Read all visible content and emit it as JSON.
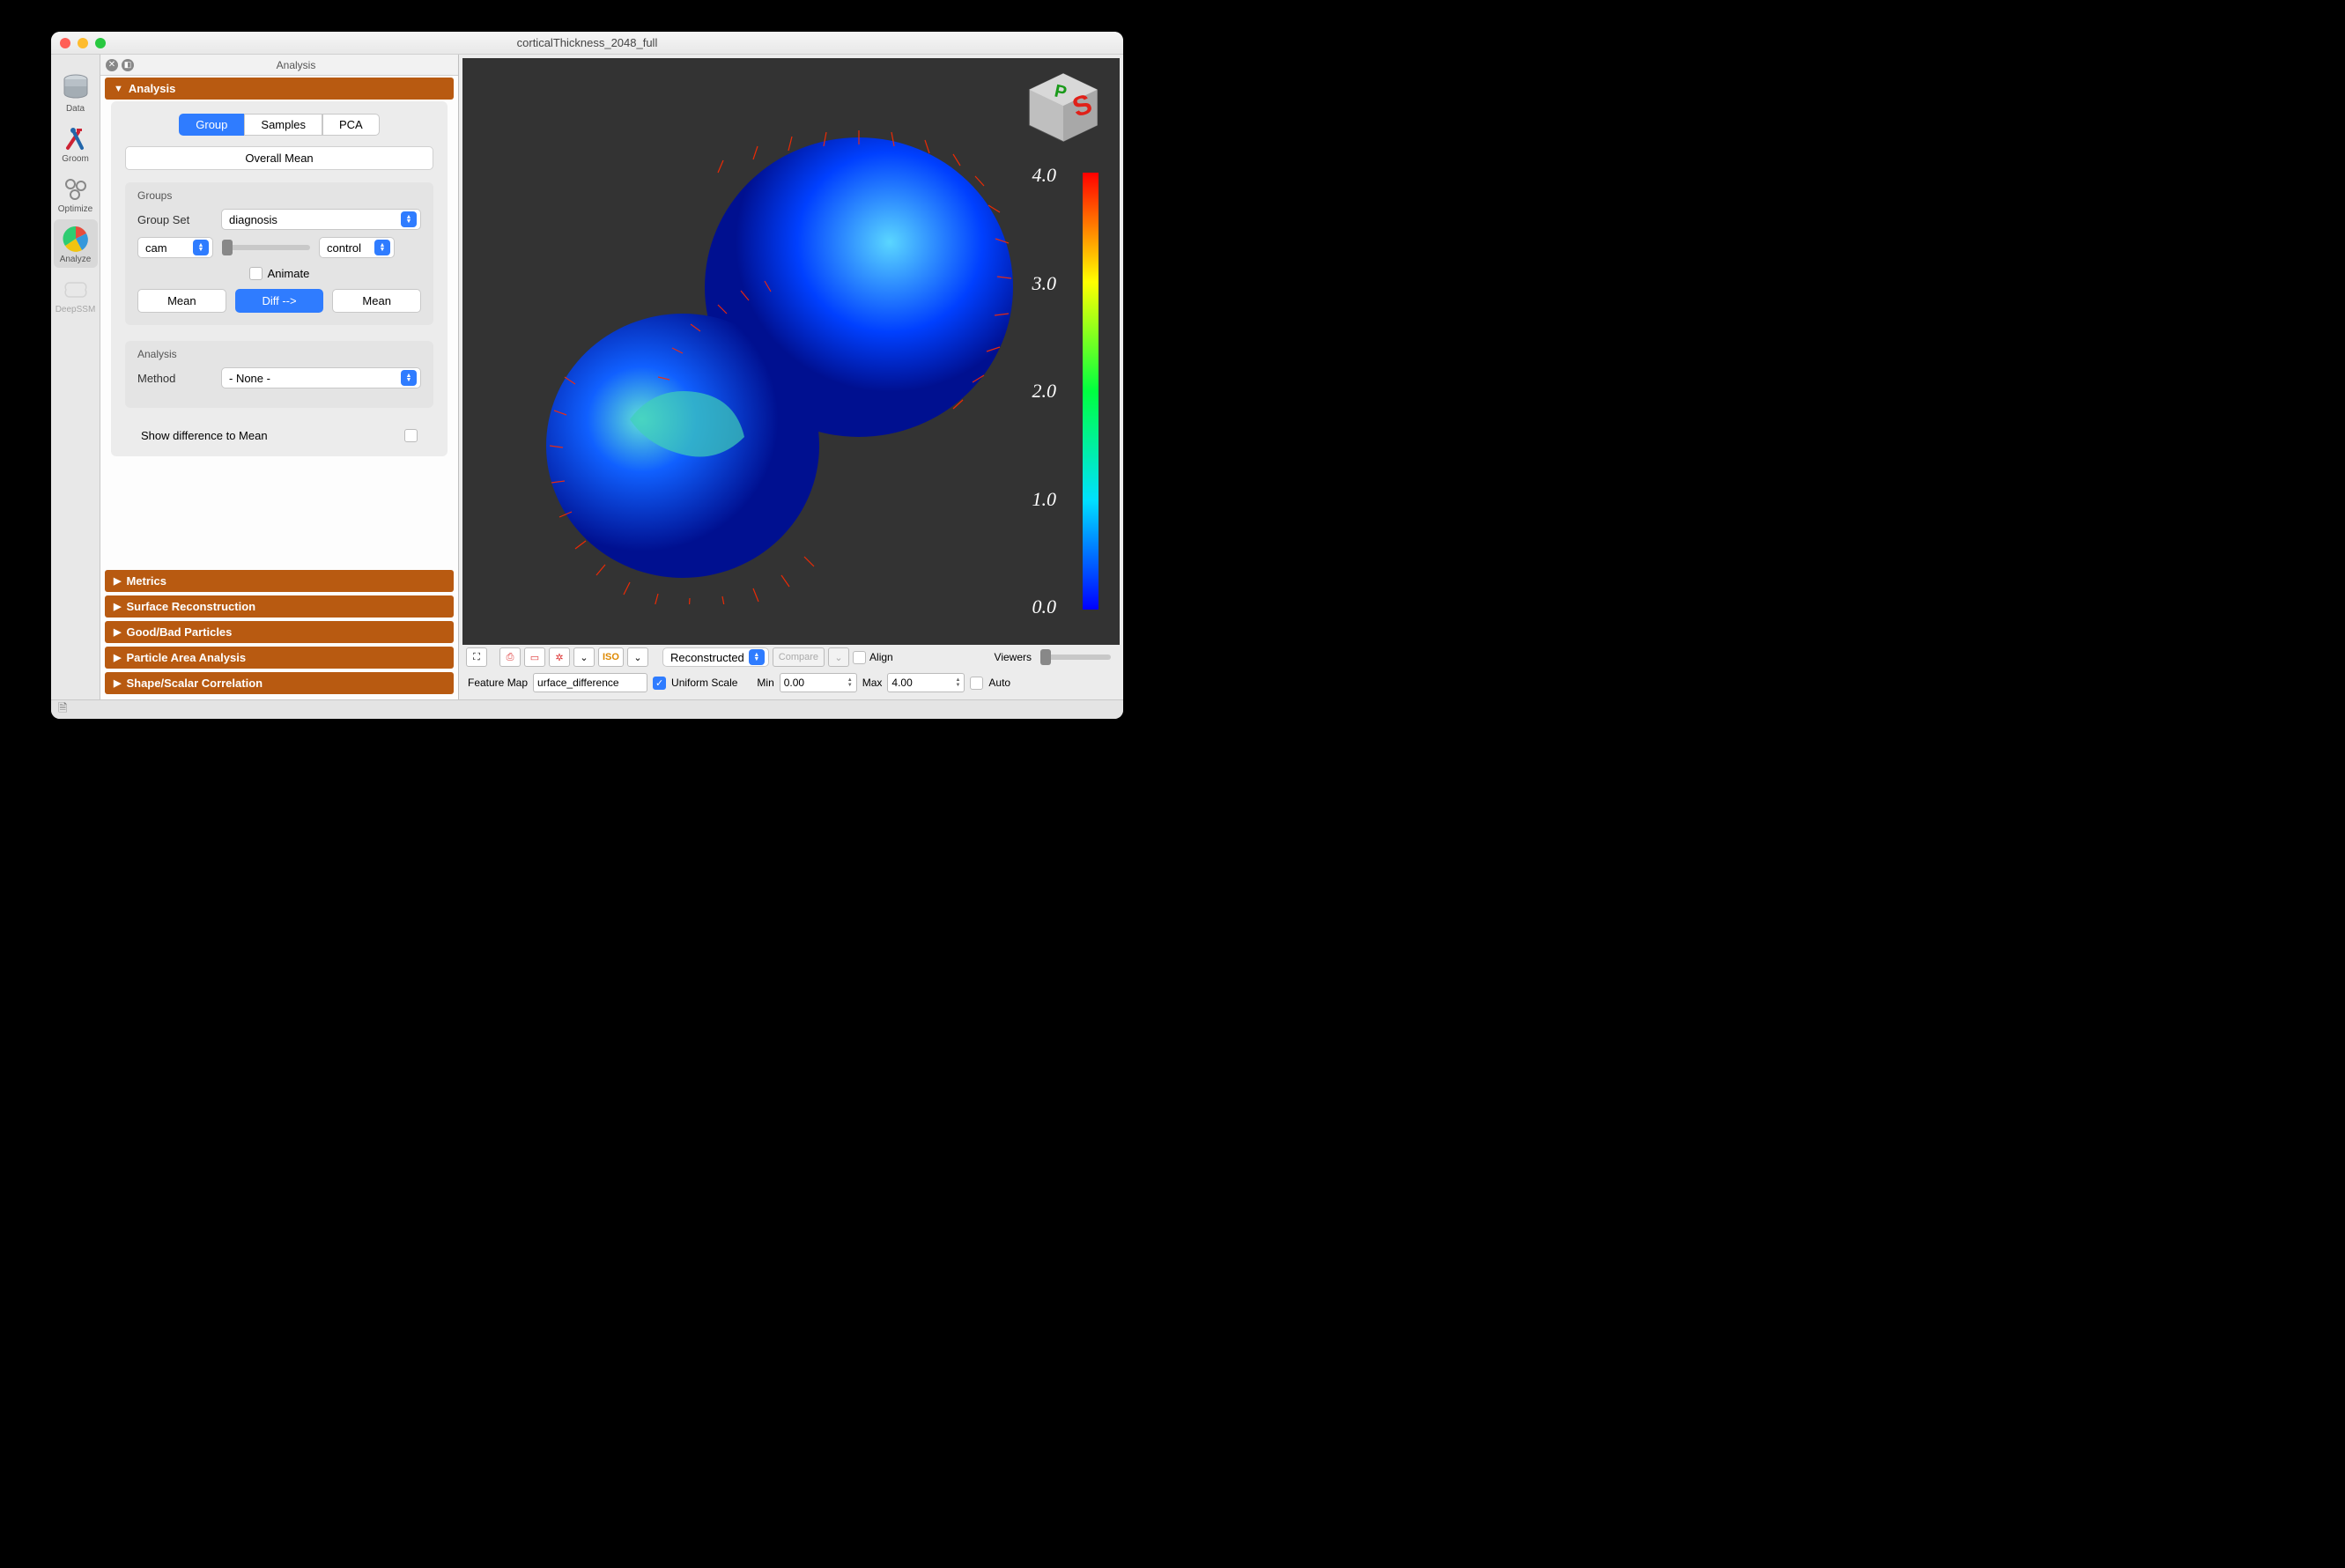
{
  "window": {
    "title": "corticalThickness_2048_full"
  },
  "left_tools": [
    {
      "id": "data",
      "label": "Data"
    },
    {
      "id": "groom",
      "label": "Groom"
    },
    {
      "id": "optimize",
      "label": "Optimize"
    },
    {
      "id": "analyze",
      "label": "Analyze"
    },
    {
      "id": "deepssm",
      "label": "DeepSSM"
    }
  ],
  "panel": {
    "title": "Analysis",
    "sections": {
      "analysis": "Analysis",
      "metrics": "Metrics",
      "surface": "Surface Reconstruction",
      "goodbad": "Good/Bad Particles",
      "particle_area": "Particle Area Analysis",
      "shape_scalar": "Shape/Scalar Correlation"
    },
    "tabs": {
      "group": "Group",
      "samples": "Samples",
      "pca": "PCA"
    },
    "overall_mean": "Overall Mean",
    "groups_label": "Groups",
    "group_set_label": "Group Set",
    "group_set_value": "diagnosis",
    "left_combo": "cam",
    "right_combo": "control",
    "animate_label": "Animate",
    "mean_left": "Mean",
    "diff_button": "Diff -->",
    "mean_right": "Mean",
    "analysis_sub_label": "Analysis",
    "method_label": "Method",
    "method_value": "- None -",
    "show_diff": "Show difference to Mean"
  },
  "colorbar": {
    "ticks": [
      "4.0",
      "3.0",
      "2.0",
      "1.0",
      "0.0"
    ]
  },
  "bottom_toolbar": {
    "reconstructed": "Reconstructed",
    "compare": "Compare",
    "align": "Align",
    "viewers": "Viewers"
  },
  "bottom_toolbar2": {
    "feature_map_label": "Feature Map",
    "feature_map_value": "urface_difference",
    "uniform_scale": "Uniform Scale",
    "min_label": "Min",
    "min_value": "0.00",
    "max_label": "Max",
    "max_value": "4.00",
    "auto": "Auto"
  }
}
